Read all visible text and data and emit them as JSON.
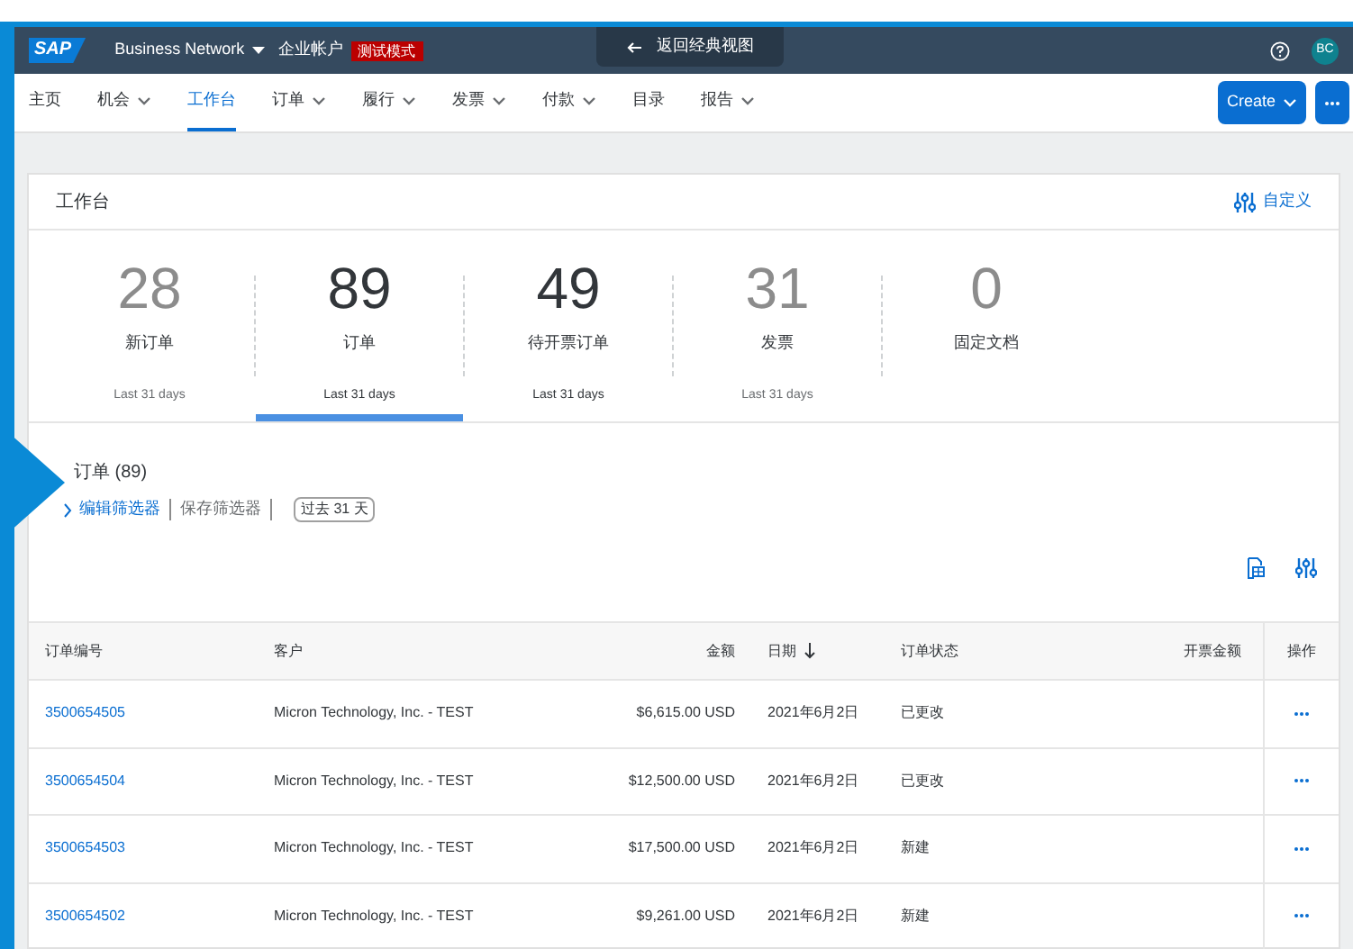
{
  "top_bar": {
    "logo": "SAP",
    "product": "Business Network",
    "account": "企业帐户",
    "mode_badge": "测试模式",
    "back_button": "返回经典视图",
    "avatar": "BC"
  },
  "nav_tabs": [
    {
      "label": "主页",
      "dropdown": false,
      "selected": false
    },
    {
      "label": "机会",
      "dropdown": true,
      "selected": false
    },
    {
      "label": "工作台",
      "dropdown": false,
      "selected": true
    },
    {
      "label": "订单",
      "dropdown": true,
      "selected": false
    },
    {
      "label": "履行",
      "dropdown": true,
      "selected": false
    },
    {
      "label": "发票",
      "dropdown": true,
      "selected": false
    },
    {
      "label": "付款",
      "dropdown": true,
      "selected": false
    },
    {
      "label": "目录",
      "dropdown": false,
      "selected": false
    },
    {
      "label": "报告",
      "dropdown": true,
      "selected": false
    }
  ],
  "create_button": "Create",
  "workbench": {
    "title": "工作台",
    "customize": "自定义",
    "tiles": [
      {
        "value": "28",
        "label": "新订单",
        "period": "Last 31 days",
        "active": false,
        "selected": false
      },
      {
        "value": "89",
        "label": "订单",
        "period": "Last 31 days",
        "active": true,
        "selected": true
      },
      {
        "value": "49",
        "label": "待开票订单",
        "period": "Last 31 days",
        "active": true,
        "selected": false
      },
      {
        "value": "31",
        "label": "发票",
        "period": "Last 31 days",
        "active": false,
        "selected": false
      },
      {
        "value": "0",
        "label": "固定文档",
        "active": false,
        "selected": false
      }
    ]
  },
  "orders": {
    "title": "订单 (89)",
    "edit_filter": "编辑筛选器",
    "save_filter": "保存筛选器",
    "period_chip": "过去 31 天",
    "columns": [
      "订单编号",
      "客户",
      "金额",
      "日期",
      "订单状态",
      "开票金额",
      "操作"
    ],
    "rows": [
      {
        "order_no": "3500654505",
        "customer": "Micron Technology, Inc. - TEST",
        "amount": "$6,615.00 USD",
        "date": "2021年6月2日",
        "status": "已更改"
      },
      {
        "order_no": "3500654504",
        "customer": "Micron Technology, Inc. - TEST",
        "amount": "$12,500.00 USD",
        "date": "2021年6月2日",
        "status": "已更改"
      },
      {
        "order_no": "3500654503",
        "customer": "Micron Technology, Inc. - TEST",
        "amount": "$17,500.00 USD",
        "date": "2021年6月2日",
        "status": "新建"
      },
      {
        "order_no": "3500654502",
        "customer": "Micron Technology, Inc. - TEST",
        "amount": "$9,261.00 USD",
        "date": "2021年6月2日",
        "status": "新建"
      }
    ]
  }
}
